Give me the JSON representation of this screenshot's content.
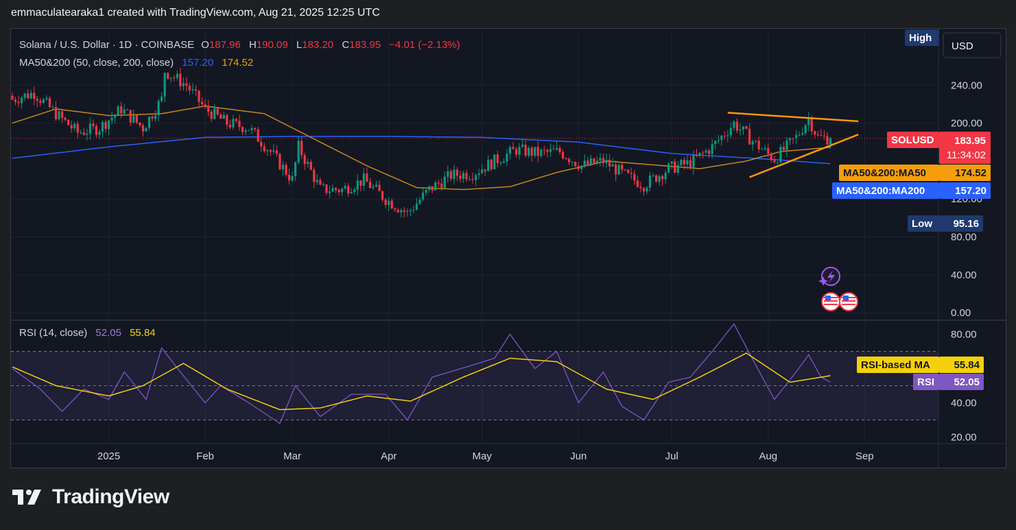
{
  "credit": "emmaculatearaka1 created with TradingView.com, Aug 21, 2025 12:25 UTC",
  "brand": "TradingView",
  "legend": {
    "symbol": "Solana / U.S. Dollar · 1D · COINBASE",
    "o_label": "O",
    "o_value": "187.96",
    "h_label": "H",
    "h_value": "190.09",
    "l_label": "L",
    "l_value": "183.20",
    "c_label": "C",
    "c_value": "183.95",
    "change": "−4.01 (−2.13%)",
    "ma_label": "MA50&200 (50, close, 200, close)",
    "ma200_value": "157.20",
    "ma50_value": "174.52",
    "rsi_label": "RSI (14, close)",
    "rsi_value": "52.05",
    "rsi_ma_value": "55.84"
  },
  "currency_button": "USD",
  "badges": {
    "high": "High",
    "low": "Low",
    "low_value": "95.16",
    "symbol": "SOLUSD",
    "price": "183.95",
    "countdown": "11:34:02",
    "ma50_name": "MA50&200:MA50",
    "ma50_value": "174.52",
    "ma200_name": "MA50&200:MA200",
    "ma200_value": "157.20",
    "rsi_ma_name": "RSI-based MA",
    "rsi_ma_value": "55.84",
    "rsi_name": "RSI",
    "rsi_value": "52.05"
  },
  "colors": {
    "up": "#089981",
    "down": "#f23645",
    "ma50": "#c8871a",
    "ma200": "#2962ff",
    "rsi": "#7e57c2",
    "rsi_ma": "#f5d10a",
    "trend": "#ff9800",
    "text": "#d1d4dc"
  },
  "chart_data": [
    {
      "type": "candlestick",
      "title": "Solana / U.S. Dollar · 1D · COINBASE",
      "x_labels": [
        "2025",
        "Feb",
        "Mar",
        "Apr",
        "May",
        "Jun",
        "Jul",
        "Aug",
        "Sep"
      ],
      "y_ticks": [
        0,
        40,
        80,
        120,
        200,
        240
      ],
      "ylim": [
        0,
        280
      ],
      "last_close": 183.95,
      "high_marker": "High",
      "low_marker": 95.16,
      "close_path": [
        {
          "date": "2024-12-01",
          "close": 225
        },
        {
          "date": "2024-12-08",
          "close": 232
        },
        {
          "date": "2024-12-15",
          "close": 210
        },
        {
          "date": "2024-12-22",
          "close": 190
        },
        {
          "date": "2024-12-29",
          "close": 195
        },
        {
          "date": "2025-01-05",
          "close": 215
        },
        {
          "date": "2025-01-12",
          "close": 195
        },
        {
          "date": "2025-01-18",
          "close": 225
        },
        {
          "date": "2025-01-19",
          "close": 255
        },
        {
          "date": "2025-01-26",
          "close": 240
        },
        {
          "date": "2025-02-01",
          "close": 215
        },
        {
          "date": "2025-02-08",
          "close": 200
        },
        {
          "date": "2025-02-15",
          "close": 195
        },
        {
          "date": "2025-02-22",
          "close": 170
        },
        {
          "date": "2025-03-01",
          "close": 140
        },
        {
          "date": "2025-03-03",
          "close": 175
        },
        {
          "date": "2025-03-10",
          "close": 130
        },
        {
          "date": "2025-03-17",
          "close": 130
        },
        {
          "date": "2025-03-24",
          "close": 140
        },
        {
          "date": "2025-03-31",
          "close": 120
        },
        {
          "date": "2025-04-07",
          "close": 105
        },
        {
          "date": "2025-04-14",
          "close": 130
        },
        {
          "date": "2025-04-21",
          "close": 145
        },
        {
          "date": "2025-04-28",
          "close": 147
        },
        {
          "date": "2025-05-05",
          "close": 160
        },
        {
          "date": "2025-05-12",
          "close": 172
        },
        {
          "date": "2025-05-19",
          "close": 168
        },
        {
          "date": "2025-05-26",
          "close": 170
        },
        {
          "date": "2025-06-02",
          "close": 155
        },
        {
          "date": "2025-06-09",
          "close": 160
        },
        {
          "date": "2025-06-16",
          "close": 145
        },
        {
          "date": "2025-06-22",
          "close": 135
        },
        {
          "date": "2025-06-30",
          "close": 152
        },
        {
          "date": "2025-07-07",
          "close": 158
        },
        {
          "date": "2025-07-14",
          "close": 175
        },
        {
          "date": "2025-07-21",
          "close": 200
        },
        {
          "date": "2025-07-28",
          "close": 178
        },
        {
          "date": "2025-08-03",
          "close": 162
        },
        {
          "date": "2025-08-10",
          "close": 185
        },
        {
          "date": "2025-08-14",
          "close": 205
        },
        {
          "date": "2025-08-17",
          "close": 185
        },
        {
          "date": "2025-08-21",
          "close": 183.95
        }
      ],
      "ma50": [
        {
          "date": "2024-12-01",
          "value": 200
        },
        {
          "date": "2024-12-15",
          "value": 215
        },
        {
          "date": "2025-01-01",
          "value": 208
        },
        {
          "date": "2025-01-18",
          "value": 210
        },
        {
          "date": "2025-02-01",
          "value": 218
        },
        {
          "date": "2025-02-20",
          "value": 210
        },
        {
          "date": "2025-03-10",
          "value": 180
        },
        {
          "date": "2025-03-25",
          "value": 155
        },
        {
          "date": "2025-04-10",
          "value": 132
        },
        {
          "date": "2025-04-25",
          "value": 130
        },
        {
          "date": "2025-05-10",
          "value": 133
        },
        {
          "date": "2025-05-25",
          "value": 148
        },
        {
          "date": "2025-06-10",
          "value": 160
        },
        {
          "date": "2025-06-25",
          "value": 156
        },
        {
          "date": "2025-07-10",
          "value": 152
        },
        {
          "date": "2025-07-25",
          "value": 160
        },
        {
          "date": "2025-08-05",
          "value": 170
        },
        {
          "date": "2025-08-21",
          "value": 174.52
        }
      ],
      "ma200": [
        {
          "date": "2024-12-01",
          "value": 163
        },
        {
          "date": "2025-01-01",
          "value": 175
        },
        {
          "date": "2025-02-01",
          "value": 185
        },
        {
          "date": "2025-03-01",
          "value": 186
        },
        {
          "date": "2025-04-01",
          "value": 186
        },
        {
          "date": "2025-05-01",
          "value": 185
        },
        {
          "date": "2025-06-01",
          "value": 180
        },
        {
          "date": "2025-07-01",
          "value": 168
        },
        {
          "date": "2025-08-01",
          "value": 162
        },
        {
          "date": "2025-08-21",
          "value": 157.2
        }
      ],
      "trendlines": [
        {
          "from": {
            "date": "2025-07-19",
            "price": 211
          },
          "to": {
            "date": "2025-08-30",
            "price": 202
          }
        },
        {
          "from": {
            "date": "2025-07-26",
            "price": 143
          },
          "to": {
            "date": "2025-08-30",
            "price": 188
          }
        }
      ]
    },
    {
      "type": "line",
      "title": "RSI (14, close)",
      "y_ticks": [
        20,
        40,
        80
      ],
      "ylim": [
        20,
        85
      ],
      "band": [
        30,
        70
      ],
      "mid_line": 50,
      "series": [
        {
          "name": "RSI",
          "points": [
            {
              "date": "2024-12-01",
              "value": 60
            },
            {
              "date": "2024-12-10",
              "value": 48
            },
            {
              "date": "2024-12-17",
              "value": 35
            },
            {
              "date": "2024-12-24",
              "value": 48
            },
            {
              "date": "2025-01-01",
              "value": 42
            },
            {
              "date": "2025-01-06",
              "value": 58
            },
            {
              "date": "2025-01-13",
              "value": 42
            },
            {
              "date": "2025-01-18",
              "value": 72
            },
            {
              "date": "2025-01-24",
              "value": 58
            },
            {
              "date": "2025-02-01",
              "value": 40
            },
            {
              "date": "2025-02-06",
              "value": 50
            },
            {
              "date": "2025-02-15",
              "value": 40
            },
            {
              "date": "2025-02-25",
              "value": 28
            },
            {
              "date": "2025-03-02",
              "value": 50
            },
            {
              "date": "2025-03-10",
              "value": 32
            },
            {
              "date": "2025-03-20",
              "value": 45
            },
            {
              "date": "2025-03-31",
              "value": 45
            },
            {
              "date": "2025-04-07",
              "value": 30
            },
            {
              "date": "2025-04-15",
              "value": 55
            },
            {
              "date": "2025-04-28",
              "value": 62
            },
            {
              "date": "2025-05-05",
              "value": 66
            },
            {
              "date": "2025-05-10",
              "value": 80
            },
            {
              "date": "2025-05-18",
              "value": 60
            },
            {
              "date": "2025-05-25",
              "value": 70
            },
            {
              "date": "2025-06-01",
              "value": 40
            },
            {
              "date": "2025-06-09",
              "value": 58
            },
            {
              "date": "2025-06-15",
              "value": 38
            },
            {
              "date": "2025-06-22",
              "value": 30
            },
            {
              "date": "2025-06-30",
              "value": 52
            },
            {
              "date": "2025-07-07",
              "value": 55
            },
            {
              "date": "2025-07-14",
              "value": 70
            },
            {
              "date": "2025-07-21",
              "value": 86
            },
            {
              "date": "2025-07-28",
              "value": 62
            },
            {
              "date": "2025-08-03",
              "value": 42
            },
            {
              "date": "2025-08-10",
              "value": 58
            },
            {
              "date": "2025-08-14",
              "value": 68
            },
            {
              "date": "2025-08-18",
              "value": 55
            },
            {
              "date": "2025-08-21",
              "value": 52.05
            }
          ]
        },
        {
          "name": "RSI-based MA",
          "points": [
            {
              "date": "2024-12-01",
              "value": 61
            },
            {
              "date": "2024-12-15",
              "value": 50
            },
            {
              "date": "2025-01-01",
              "value": 44
            },
            {
              "date": "2025-01-12",
              "value": 50
            },
            {
              "date": "2025-01-25",
              "value": 63
            },
            {
              "date": "2025-02-08",
              "value": 48
            },
            {
              "date": "2025-02-25",
              "value": 36
            },
            {
              "date": "2025-03-10",
              "value": 37
            },
            {
              "date": "2025-03-25",
              "value": 44
            },
            {
              "date": "2025-04-08",
              "value": 41
            },
            {
              "date": "2025-04-25",
              "value": 55
            },
            {
              "date": "2025-05-10",
              "value": 66
            },
            {
              "date": "2025-05-25",
              "value": 64
            },
            {
              "date": "2025-06-10",
              "value": 48
            },
            {
              "date": "2025-06-25",
              "value": 42
            },
            {
              "date": "2025-07-10",
              "value": 55
            },
            {
              "date": "2025-07-25",
              "value": 69
            },
            {
              "date": "2025-08-08",
              "value": 52
            },
            {
              "date": "2025-08-21",
              "value": 55.84
            }
          ]
        }
      ]
    }
  ]
}
